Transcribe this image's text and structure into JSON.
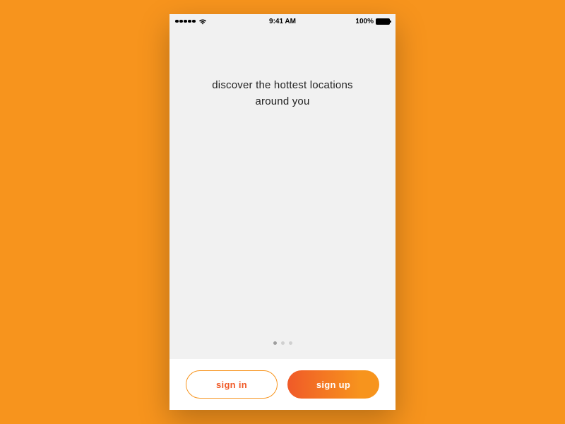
{
  "statusBar": {
    "time": "9:41 AM",
    "battery": "100%"
  },
  "onboarding": {
    "headline_line1": "discover the hottest locations",
    "headline_line2": "around you",
    "current_page_index": 0,
    "page_count": 3
  },
  "buttons": {
    "signin": "sign in",
    "signup": "sign up"
  }
}
